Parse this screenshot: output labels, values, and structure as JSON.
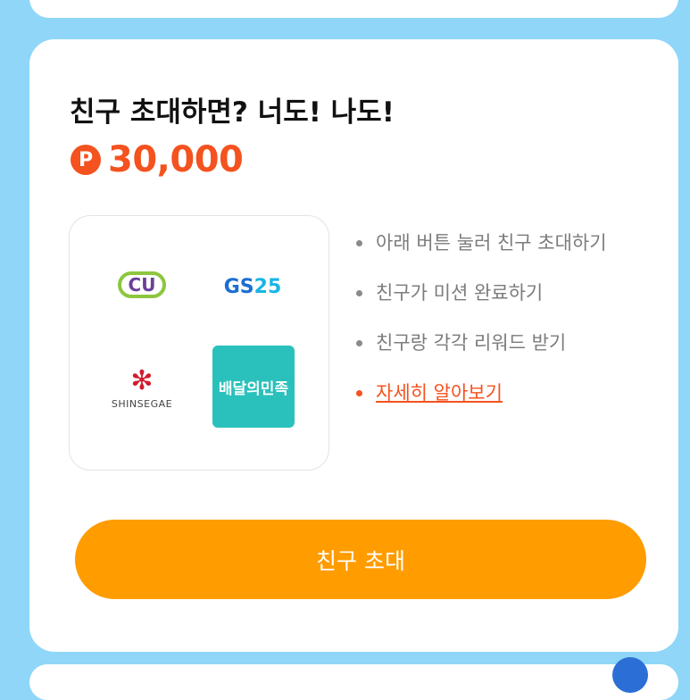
{
  "colors": {
    "background": "#8fd6f9",
    "accent": "#f4521f",
    "button": "#ff9c00"
  },
  "promo": {
    "title": "친구 초대하면? 너도! 나도!",
    "point_icon": "P",
    "reward_amount": "30,000"
  },
  "partners": [
    {
      "name": "CU",
      "icon": "cu-logo"
    },
    {
      "name": "GS25",
      "icon": "gs25-logo"
    },
    {
      "name": "SHINSEGAE",
      "icon": "shinsegae-logo"
    },
    {
      "name": "배달의민족",
      "icon": "baemin-logo"
    }
  ],
  "steps": [
    "아래 버튼 눌러 친구 초대하기",
    "친구가 미션 완료하기",
    "친구랑 각각 리워드 받기"
  ],
  "more_link": "자세히 알아보기",
  "invite_button": "친구 초대"
}
